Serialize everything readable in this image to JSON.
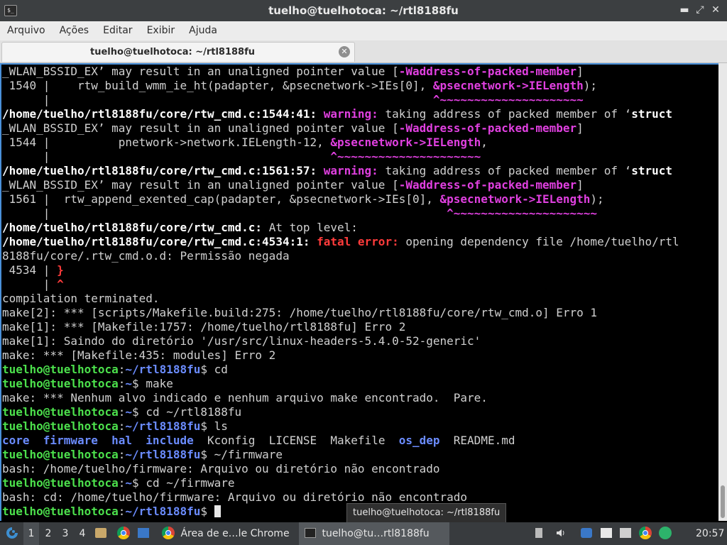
{
  "window": {
    "title": "tuelho@tuelhotoca: ~/rtl8188fu",
    "app_icon_glyph": "$_",
    "controls": {
      "minimize": "▬",
      "maximize": "⤢",
      "close": "✕"
    }
  },
  "menu": [
    "Arquivo",
    "Ações",
    "Editar",
    "Exibir",
    "Ajuda"
  ],
  "tab": {
    "label": "tuelho@tuelhotoca: ~/rtl8188fu",
    "close_glyph": "✕"
  },
  "terminal_lines": [
    [
      {
        "t": "_WLAN_BSSID_EX’ may result in an unaligned pointer value [",
        "c": ""
      },
      {
        "t": "-Waddress-of-packed-member",
        "c": "mag"
      },
      {
        "t": "]",
        "c": ""
      }
    ],
    [
      {
        "t": " 1540 |    rtw_build_wmm_ie_ht(padapter, &psecnetwork->IEs[0], ",
        "c": ""
      },
      {
        "t": "&psecnetwork->IELength",
        "c": "mag"
      },
      {
        "t": ");",
        "c": ""
      }
    ],
    [
      {
        "t": "      |                                                        ",
        "c": ""
      },
      {
        "t": "^~~~~~~~~~~~~~~~~~~~~~",
        "c": "mag"
      }
    ],
    [
      {
        "t": "/home/tuelho/rtl8188fu/core/rtw_cmd.c:1544:41: ",
        "c": "wht"
      },
      {
        "t": "warning: ",
        "c": "mag"
      },
      {
        "t": "taking address of packed member of ‘",
        "c": ""
      },
      {
        "t": "struct",
        "c": "wht"
      }
    ],
    [
      {
        "t": "_WLAN_BSSID_EX’ may result in an unaligned pointer value [",
        "c": ""
      },
      {
        "t": "-Waddress-of-packed-member",
        "c": "mag"
      },
      {
        "t": "]",
        "c": ""
      }
    ],
    [
      {
        "t": " 1544 |          pnetwork->network.IELength-12, ",
        "c": ""
      },
      {
        "t": "&psecnetwork->IELength",
        "c": "mag"
      },
      {
        "t": ",",
        "c": ""
      }
    ],
    [
      {
        "t": "      |                                         ",
        "c": ""
      },
      {
        "t": "^~~~~~~~~~~~~~~~~~~~~~",
        "c": "mag"
      }
    ],
    [
      {
        "t": "/home/tuelho/rtl8188fu/core/rtw_cmd.c:1561:57: ",
        "c": "wht"
      },
      {
        "t": "warning: ",
        "c": "mag"
      },
      {
        "t": "taking address of packed member of ‘",
        "c": ""
      },
      {
        "t": "struct",
        "c": "wht"
      }
    ],
    [
      {
        "t": "_WLAN_BSSID_EX’ may result in an unaligned pointer value [",
        "c": ""
      },
      {
        "t": "-Waddress-of-packed-member",
        "c": "mag"
      },
      {
        "t": "]",
        "c": ""
      }
    ],
    [
      {
        "t": " 1561 |  rtw_append_exented_cap(padapter, &psecnetwork->IEs[0], ",
        "c": ""
      },
      {
        "t": "&psecnetwork->IELength",
        "c": "mag"
      },
      {
        "t": ");",
        "c": ""
      }
    ],
    [
      {
        "t": "      |                                                          ",
        "c": ""
      },
      {
        "t": "^~~~~~~~~~~~~~~~~~~~~~",
        "c": "mag"
      }
    ],
    [
      {
        "t": "/home/tuelho/rtl8188fu/core/rtw_cmd.c: ",
        "c": "wht"
      },
      {
        "t": "At top level:",
        "c": ""
      }
    ],
    [
      {
        "t": "/home/tuelho/rtl8188fu/core/rtw_cmd.c:4534:1: ",
        "c": "wht"
      },
      {
        "t": "fatal error: ",
        "c": "red"
      },
      {
        "t": "opening dependency file /home/tuelho/rtl",
        "c": ""
      }
    ],
    [
      {
        "t": "8188fu/core/.rtw_cmd.o.d: Permissão negada",
        "c": ""
      }
    ],
    [
      {
        "t": " 4534 | ",
        "c": ""
      },
      {
        "t": "}",
        "c": "red"
      }
    ],
    [
      {
        "t": "      | ",
        "c": ""
      },
      {
        "t": "^",
        "c": "red"
      }
    ],
    [
      {
        "t": "compilation terminated.",
        "c": ""
      }
    ],
    [
      {
        "t": "make[2]: *** [scripts/Makefile.build:275: /home/tuelho/rtl8188fu/core/rtw_cmd.o] Erro 1",
        "c": ""
      }
    ],
    [
      {
        "t": "make[1]: *** [Makefile:1757: /home/tuelho/rtl8188fu] Erro 2",
        "c": ""
      }
    ],
    [
      {
        "t": "make[1]: Saindo do diretório '/usr/src/linux-headers-5.4.0-52-generic'",
        "c": ""
      }
    ],
    [
      {
        "t": "make: *** [Makefile:435: modules] Erro 2",
        "c": ""
      }
    ],
    [
      {
        "t": "tuelho@tuelhotoca",
        "c": "grn"
      },
      {
        "t": ":",
        "c": ""
      },
      {
        "t": "~/rtl8188fu",
        "c": "blu"
      },
      {
        "t": "$ cd",
        "c": ""
      }
    ],
    [
      {
        "t": "tuelho@tuelhotoca",
        "c": "grn"
      },
      {
        "t": ":",
        "c": ""
      },
      {
        "t": "~",
        "c": "blu"
      },
      {
        "t": "$ make",
        "c": ""
      }
    ],
    [
      {
        "t": "make: *** Nenhum alvo indicado e nenhum arquivo make encontrado.  Pare.",
        "c": ""
      }
    ],
    [
      {
        "t": "tuelho@tuelhotoca",
        "c": "grn"
      },
      {
        "t": ":",
        "c": ""
      },
      {
        "t": "~",
        "c": "blu"
      },
      {
        "t": "$ cd ~/rtl8188fu",
        "c": ""
      }
    ],
    [
      {
        "t": "tuelho@tuelhotoca",
        "c": "grn"
      },
      {
        "t": ":",
        "c": ""
      },
      {
        "t": "~/rtl8188fu",
        "c": "blu"
      },
      {
        "t": "$ ls",
        "c": ""
      }
    ],
    [
      {
        "t": "core",
        "c": "blu"
      },
      {
        "t": "  ",
        "c": ""
      },
      {
        "t": "firmware",
        "c": "blu"
      },
      {
        "t": "  ",
        "c": ""
      },
      {
        "t": "hal",
        "c": "blu"
      },
      {
        "t": "  ",
        "c": ""
      },
      {
        "t": "include",
        "c": "blu"
      },
      {
        "t": "  Kconfig  LICENSE  Makefile  ",
        "c": ""
      },
      {
        "t": "os_dep",
        "c": "blu"
      },
      {
        "t": "  README.md",
        "c": ""
      }
    ],
    [
      {
        "t": "tuelho@tuelhotoca",
        "c": "grn"
      },
      {
        "t": ":",
        "c": ""
      },
      {
        "t": "~/rtl8188fu",
        "c": "blu"
      },
      {
        "t": "$ ~/firmware",
        "c": ""
      }
    ],
    [
      {
        "t": "bash: /home/tuelho/firmware: Arquivo ou diretório não encontrado",
        "c": ""
      }
    ],
    [
      {
        "t": "tuelho@tuelhotoca",
        "c": "grn"
      },
      {
        "t": ":",
        "c": ""
      },
      {
        "t": "~",
        "c": "blu"
      },
      {
        "t": "$ cd ~/firmware",
        "c": ""
      }
    ],
    [
      {
        "t": "bash: cd: /home/tuelho/firmware: Arquivo ou diretório não encontrado",
        "c": ""
      }
    ],
    [
      {
        "t": "tuelho@tuelhotoca",
        "c": "grn"
      },
      {
        "t": ":",
        "c": ""
      },
      {
        "t": "~/rtl8188fu",
        "c": "blu"
      },
      {
        "t": "$ ",
        "c": ""
      },
      {
        "t": "",
        "c": "cursor"
      }
    ]
  ],
  "tooltip": "tuelho@tuelhotoca: ~/rtl8188fu",
  "taskbar": {
    "workspaces": [
      "1",
      "2",
      "3",
      "4"
    ],
    "active_workspace": "1",
    "tasks": [
      {
        "label": "Área de e…le Chrome",
        "icon": "chrome-icon"
      },
      {
        "label": "tuelho@tu…rtl8188fu",
        "icon": "terminal-icon"
      }
    ],
    "clock": "20:57",
    "colors": {
      "panel_bg": "#383b3e",
      "accent": "#4a90d9"
    }
  }
}
